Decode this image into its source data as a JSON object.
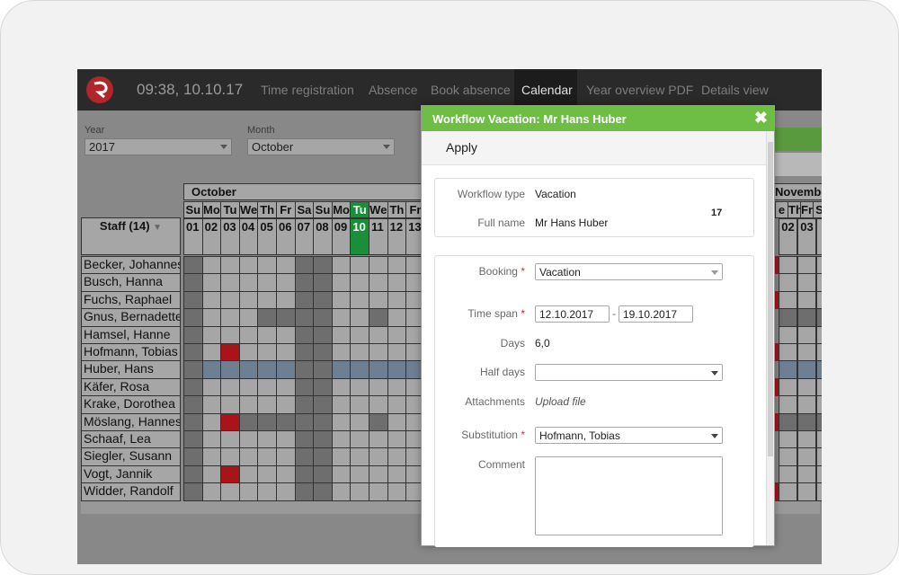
{
  "header": {
    "clock": "09:38, 10.10.17",
    "nav": [
      "Time registration",
      "Absence",
      "Book absence",
      "Calendar",
      "Year overview PDF",
      "Details view"
    ],
    "active_nav": "Calendar"
  },
  "filters": {
    "year_label": "Year",
    "year_value": "2017",
    "month_label": "Month",
    "month_value": "October"
  },
  "calendar": {
    "month": "October",
    "next_month": "Novembe",
    "staff_header": "Staff (14)",
    "weekdays": [
      "Su",
      "Mo",
      "Tu",
      "We",
      "Th",
      "Fr",
      "Sa",
      "Su",
      "Mo",
      "Tu",
      "We",
      "Th",
      "Fr"
    ],
    "days": [
      "01",
      "02",
      "03",
      "04",
      "05",
      "06",
      "07",
      "08",
      "09",
      "10",
      "11",
      "12",
      "13"
    ],
    "right_weekdays": [
      "e",
      "Th",
      "Fr",
      "S"
    ],
    "right_days": [
      "02",
      "03",
      "0"
    ],
    "staff": [
      "Becker, Johannes",
      "Busch, Hanna",
      "Fuchs, Raphael",
      "Gnus, Bernadette",
      "Hamsel, Hanne",
      "Hofmann, Tobias",
      "Huber, Hans",
      "Käfer, Rosa",
      "Krake, Dorothea",
      "Möslang, Hannes",
      "Schaaf, Lea",
      "Siegler, Susann",
      "Vogt, Jannik",
      "Widder, Randolf"
    ],
    "colors": {
      "today": "#1a8f3a",
      "absence": "#a8141a",
      "vacation": "#6f7f92",
      "weekend": "#6e6e6e",
      "workday": "#a6a6a6"
    }
  },
  "modal": {
    "title": "Workflow Vacation: Mr Hans Huber",
    "close": "✖",
    "apply": "Apply",
    "badge": "17",
    "workflow_type_label": "Workflow type",
    "workflow_type_value": "Vacation",
    "full_name_label": "Full name",
    "full_name_value": "Mr Hans Huber",
    "booking_label": "Booking",
    "booking_value": "Vacation",
    "time_span_label": "Time span",
    "time_from": "12.10.2017",
    "time_sep": "-",
    "time_to": "19.10.2017",
    "days_label": "Days",
    "days_value": "6,0",
    "half_days_label": "Half days",
    "half_days_value": "",
    "attachments_label": "Attachments",
    "upload_label": "Upload file",
    "substitution_label": "Substitution",
    "substitution_value": "Hofmann, Tobias",
    "comment_label": "Comment",
    "required_mark": "*"
  }
}
